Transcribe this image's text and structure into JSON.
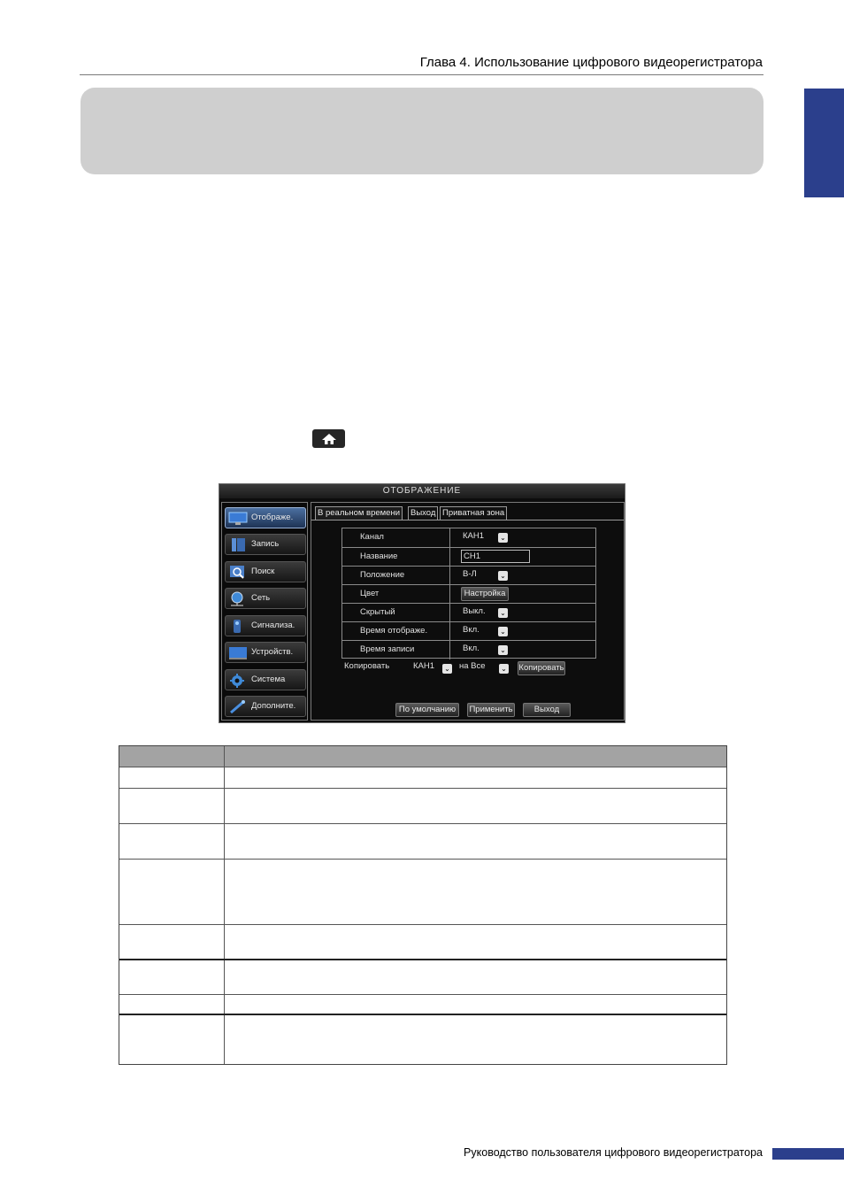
{
  "header": {
    "chapter_title": "Глава 4. Использование цифрового видеорегистратора"
  },
  "dvr": {
    "window_title": "ОТОБРАЖЕНИЕ",
    "menu": [
      {
        "label": "Отображе.",
        "icon": "monitor-icon"
      },
      {
        "label": "Запись",
        "icon": "record-icon"
      },
      {
        "label": "Поиск",
        "icon": "search-icon"
      },
      {
        "label": "Сеть",
        "icon": "network-icon"
      },
      {
        "label": "Сигнализа.",
        "icon": "alarm-icon"
      },
      {
        "label": "Устройств.",
        "icon": "device-icon"
      },
      {
        "label": "Система",
        "icon": "gear-icon"
      },
      {
        "label": "Дополните.",
        "icon": "tools-icon"
      }
    ],
    "tabs": [
      "В реальном времени",
      "Выход",
      "Приватная зона"
    ],
    "settings": [
      {
        "label": "Канал",
        "value": "КАН1",
        "control": "dropdown"
      },
      {
        "label": "Название",
        "value": "CH1",
        "control": "text"
      },
      {
        "label": "Положение",
        "value": "В-Л",
        "control": "dropdown"
      },
      {
        "label": "Цвет",
        "value": "Настройка",
        "control": "button"
      },
      {
        "label": "Скрытый",
        "value": "Выкл.",
        "control": "dropdown"
      },
      {
        "label": "Время отображе.",
        "value": "Вкл.",
        "control": "dropdown"
      },
      {
        "label": "Время записи",
        "value": "Вкл.",
        "control": "dropdown"
      }
    ],
    "copy": {
      "label": "Копировать",
      "from": "КАН1",
      "to_label": "на Все",
      "button": "Копировать"
    },
    "buttons": {
      "default": "По умолчанию",
      "apply": "Применить",
      "exit": "Выход"
    }
  },
  "footer": {
    "text": "Руководство пользователя цифрового видеорегистратора"
  },
  "colors": {
    "accent": "#2b3f8c",
    "banner": "#cfcfcf",
    "table_header": "#a3a3a3"
  },
  "icons": {
    "home": "home-icon"
  }
}
